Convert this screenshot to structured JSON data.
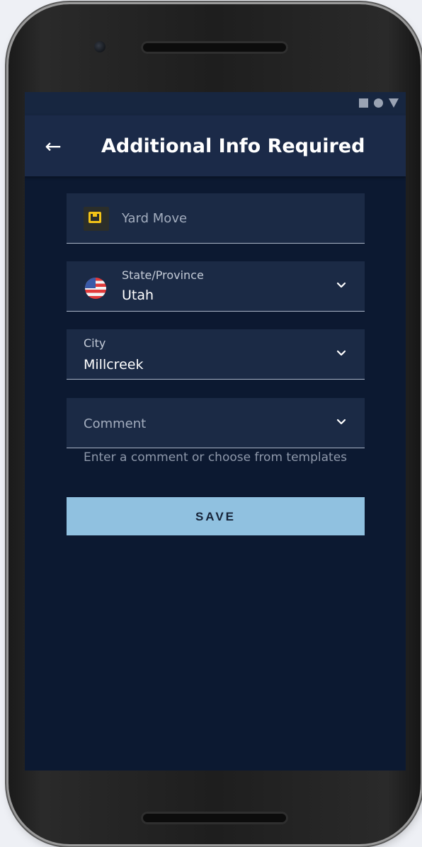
{
  "status_bar": {
    "icons": [
      "square-icon",
      "circle-icon",
      "triangle-icon"
    ]
  },
  "app_bar": {
    "title": "Additional Info Required",
    "back_icon": "arrow-left-icon"
  },
  "form": {
    "yard_move": {
      "label": "Yard Move",
      "icon": "yard-move-icon",
      "icon_color": "#f3c417"
    },
    "state": {
      "label": "State/Province",
      "value": "Utah",
      "icon": "us-flag-icon"
    },
    "city": {
      "label": "City",
      "value": "Millcreek"
    },
    "comment": {
      "placeholder": "Comment",
      "helper": "Enter a comment or choose from templates"
    },
    "save_label": "SAVE"
  },
  "colors": {
    "background": "#0c1931",
    "app_bar": "#1b2a48",
    "field": "#1b2a45",
    "save_button": "#90c1e0"
  }
}
